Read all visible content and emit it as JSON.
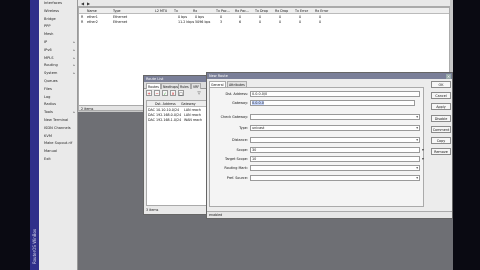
{
  "sidebar": {
    "vertical_text": "RouterOS WinBox",
    "items": [
      {
        "label": "Interfaces",
        "arrow": ""
      },
      {
        "label": "Wireless",
        "arrow": ""
      },
      {
        "label": "Bridge",
        "arrow": ""
      },
      {
        "label": "PPP",
        "arrow": ""
      },
      {
        "label": "Mesh",
        "arrow": ""
      },
      {
        "label": "IP",
        "arrow": "▸"
      },
      {
        "label": "IPv6",
        "arrow": "▸"
      },
      {
        "label": "MPLS",
        "arrow": "▸"
      },
      {
        "label": "Routing",
        "arrow": "▸"
      },
      {
        "label": "System",
        "arrow": "▸"
      },
      {
        "label": "Queues",
        "arrow": ""
      },
      {
        "label": "Files",
        "arrow": ""
      },
      {
        "label": "Log",
        "arrow": ""
      },
      {
        "label": "Radius",
        "arrow": ""
      },
      {
        "label": "Tools",
        "arrow": "▸"
      },
      {
        "label": "New Terminal",
        "arrow": ""
      },
      {
        "label": "ISDN Channels",
        "arrow": ""
      },
      {
        "label": "KVM",
        "arrow": ""
      },
      {
        "label": "Make Supout.rif",
        "arrow": ""
      },
      {
        "label": "Manual",
        "arrow": ""
      },
      {
        "label": "Exit",
        "arrow": ""
      }
    ]
  },
  "interfaces": {
    "headers": [
      "Name",
      "Type",
      "L2 MTU",
      "Tx",
      "Rx",
      "Tx Pac...",
      "Rx Pac...",
      "Tx Drop",
      "Rx Drop",
      "Tx Error",
      "Rx Error"
    ],
    "rows": [
      [
        "ether1",
        "Ethernet",
        "",
        "0 bps",
        "0 bps",
        "0",
        "0",
        "0",
        "0",
        "0",
        "0"
      ],
      [
        "ether2",
        "Ethernet",
        "",
        "11.2 kbps",
        "5096 bps",
        "3",
        "6",
        "0",
        "0",
        "0",
        "0"
      ]
    ],
    "status": "2 items"
  },
  "ip_window": {
    "title": "Route List",
    "tabs": [
      "Routes",
      "Nexthops",
      "Rules",
      "VRF"
    ],
    "headers": [
      "Dst. Address",
      "Gateway"
    ],
    "rows": [
      {
        "flag": "DAC",
        "dst": "10.10.10.0/24",
        "gw": "LAN reach"
      },
      {
        "flag": "DAC",
        "dst": "192.168.0.0/24",
        "gw": "LAN reach"
      },
      {
        "flag": "DAC",
        "dst": "192.168.1.0/24",
        "gw": "WAN reach"
      }
    ],
    "status": "3 items"
  },
  "route_window": {
    "title": "New Route",
    "tabs": [
      "General",
      "Attributes"
    ],
    "fields": [
      {
        "label": "Dst. Address:",
        "value": "0.0.0.0/0",
        "type": "text"
      },
      {
        "label": "Gateway:",
        "value": "0.0.0.0",
        "type": "gateway"
      },
      {
        "label": "Check Gateway:",
        "value": "",
        "type": "select"
      },
      {
        "label": "Type:",
        "value": "unicast",
        "type": "select"
      },
      {
        "label": "Distance:",
        "value": "",
        "type": "select"
      },
      {
        "label": "Scope:",
        "value": "30",
        "type": "text"
      },
      {
        "label": "Target Scope:",
        "value": "10",
        "type": "text"
      },
      {
        "label": "Routing Mark:",
        "value": "",
        "type": "select"
      },
      {
        "label": "Pref. Source:",
        "value": "",
        "type": "select"
      }
    ],
    "buttons": [
      "OK",
      "Cancel",
      "Apply",
      "Disable",
      "Comment",
      "Copy",
      "Remove"
    ],
    "status": "enabled"
  },
  "colors": {
    "sidebar_strip": "#2f2f8a",
    "title_bar": "#7a7f98",
    "desktop": "#6e6f74"
  }
}
